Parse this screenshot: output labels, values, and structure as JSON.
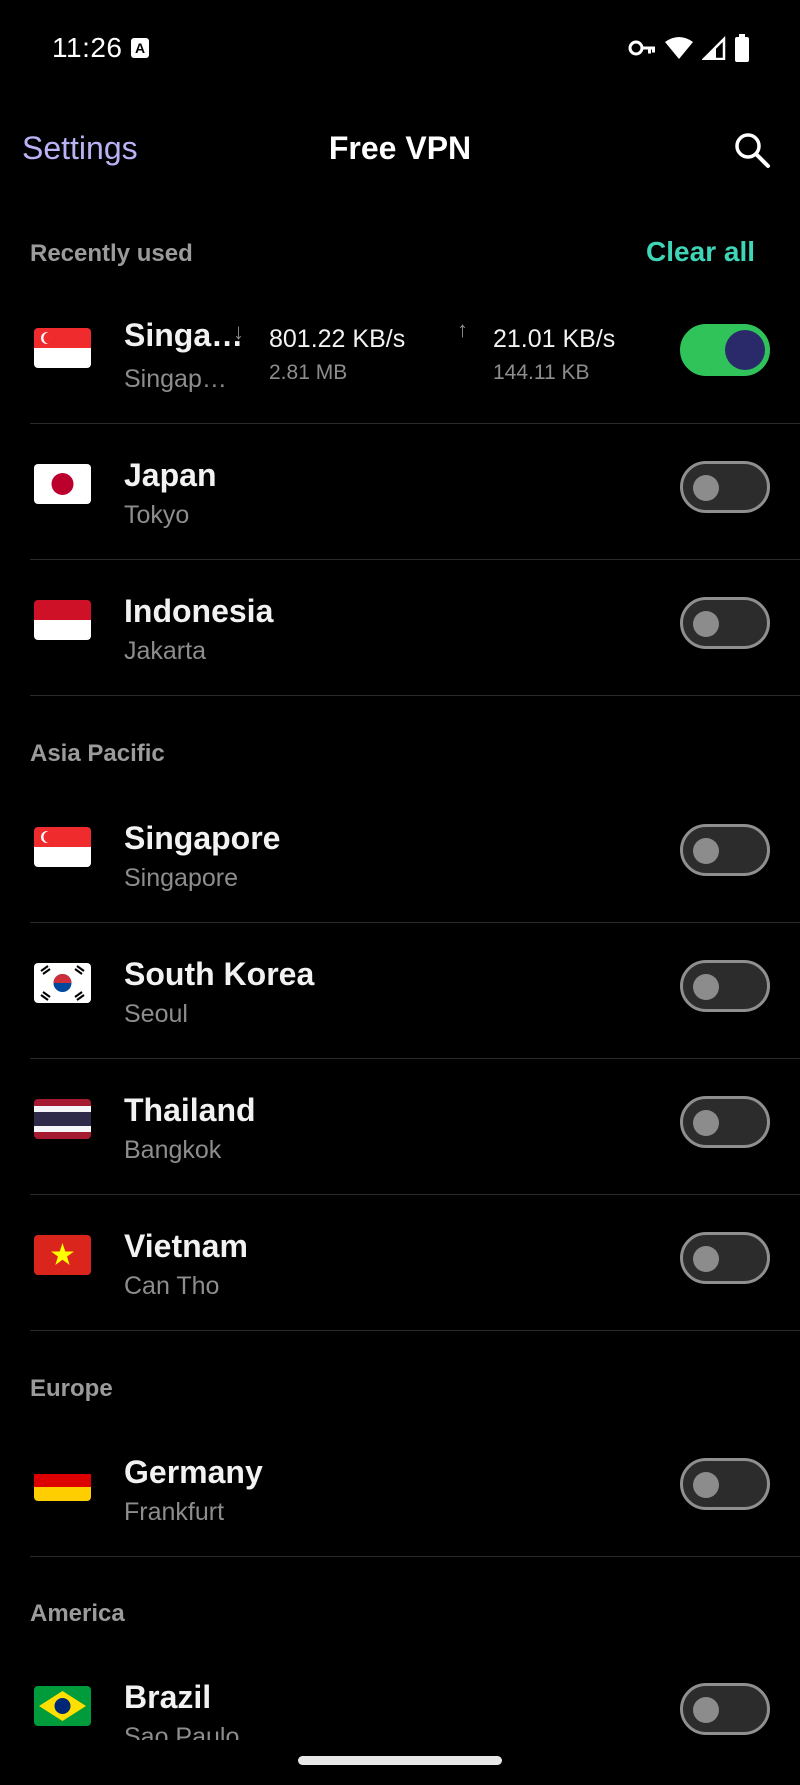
{
  "status": {
    "time": "11:26",
    "a_icon": "A"
  },
  "appbar": {
    "settings": "Settings",
    "title": "Free VPN"
  },
  "sections": {
    "recent": "Recently used",
    "clear_all": "Clear all",
    "asia": "Asia Pacific",
    "europe": "Europe",
    "america": "America"
  },
  "active": {
    "name": "Singa…",
    "city": "Singap…",
    "down_speed": "801.22 KB/s",
    "down_total": "2.81 MB",
    "up_speed": "21.01 KB/s",
    "up_total": "144.11 KB"
  },
  "rows": [
    {
      "name": "Japan",
      "city": "Tokyo"
    },
    {
      "name": "Indonesia",
      "city": "Jakarta"
    },
    {
      "name": "Singapore",
      "city": "Singapore"
    },
    {
      "name": "South Korea",
      "city": "Seoul"
    },
    {
      "name": "Thailand",
      "city": "Bangkok"
    },
    {
      "name": "Vietnam",
      "city": "Can Tho"
    },
    {
      "name": "Germany",
      "city": "Frankfurt"
    },
    {
      "name": "Brazil",
      "city": "Sao Paulo"
    }
  ],
  "colors": {
    "accent": "#b9b3f5",
    "clear": "#3fd6b8",
    "toggle_on": "#2fc35a"
  }
}
